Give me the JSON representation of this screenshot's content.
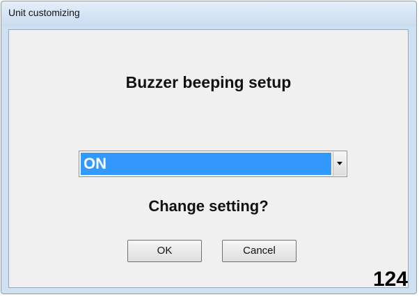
{
  "window": {
    "title": "Unit customizing"
  },
  "dialog": {
    "heading": "Buzzer beeping setup",
    "select": {
      "value": "ON"
    },
    "question": "Change setting?",
    "ok_label": "OK",
    "cancel_label": "Cancel"
  },
  "page_number": "124",
  "colors": {
    "selection": "#3399ff",
    "titlebar": "#cfe0f1",
    "client_bg": "#f0f0f0"
  },
  "icons": {
    "dropdown": "chevron-down-icon"
  }
}
